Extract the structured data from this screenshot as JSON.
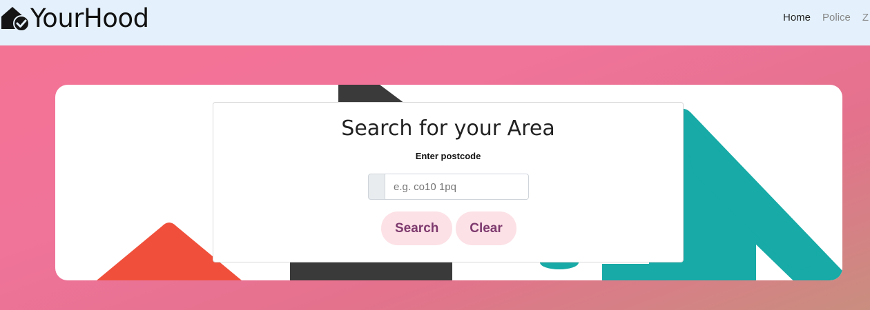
{
  "navbar": {
    "brand": "YourHood",
    "logo_icon": "house-check-icon",
    "links": [
      {
        "label": "Home",
        "active": true
      },
      {
        "label": "Police",
        "active": false
      },
      {
        "label": "Z",
        "active": false
      }
    ]
  },
  "search": {
    "title": "Search for your Area",
    "label": "Enter postcode",
    "input_value": "",
    "placeholder": "e.g. co10 1pq",
    "search_button": "Search",
    "clear_button": "Clear"
  },
  "colors": {
    "navbar_bg": "#e4f1fc",
    "button_bg": "#fce1e6",
    "button_text": "#7e3a6e",
    "art_red": "#f0503b",
    "art_dark": "#3a3a3a",
    "art_teal": "#17aaa6"
  }
}
